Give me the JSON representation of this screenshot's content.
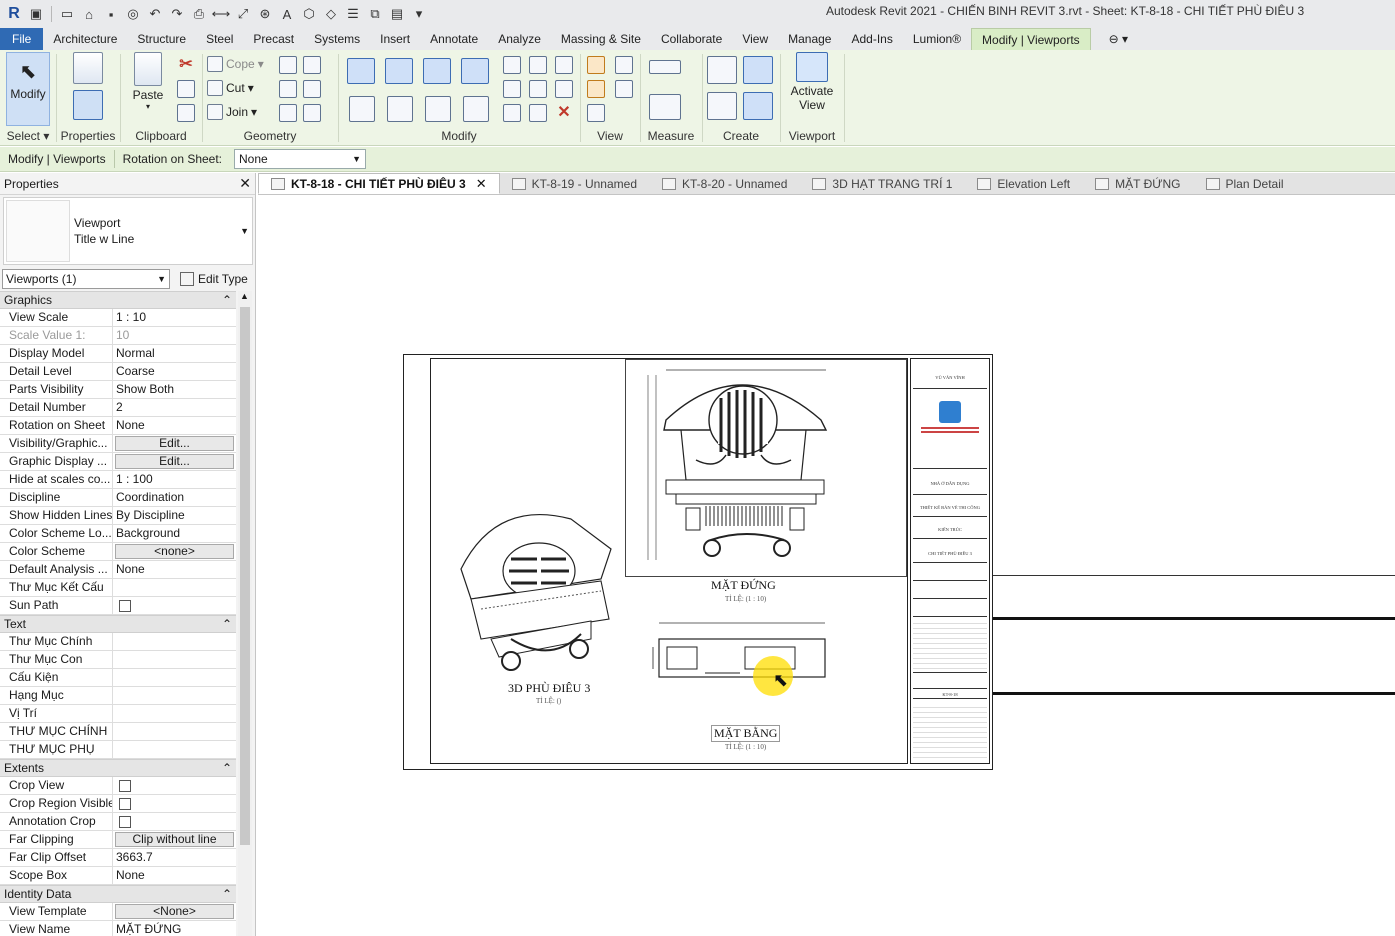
{
  "app": {
    "title": "Autodesk Revit 2021 - CHIẾN BINH REVIT 3.rvt - Sheet: KT-8-18 - CHI TIẾT PHÙ ĐIÊU 3",
    "logo": "R"
  },
  "ribbon_tabs": [
    "File",
    "Architecture",
    "Structure",
    "Steel",
    "Precast",
    "Systems",
    "Insert",
    "Annotate",
    "Analyze",
    "Massing & Site",
    "Collaborate",
    "View",
    "Manage",
    "Add-Ins",
    "Lumion®",
    "Modify | Viewports"
  ],
  "ribbon": {
    "select": {
      "modify": "Modify",
      "label": "Select ▾"
    },
    "properties": {
      "label": "Properties"
    },
    "clipboard": {
      "paste": "Paste",
      "label": "Clipboard"
    },
    "geometry": {
      "cope": "Cope",
      "cut": "Cut",
      "join": "Join",
      "label": "Geometry"
    },
    "modify_panel": {
      "label": "Modify"
    },
    "view_panel": {
      "label": "View"
    },
    "measure_panel": {
      "label": "Measure"
    },
    "create_panel": {
      "label": "Create"
    },
    "viewport_panel": {
      "activate_line1": "Activate",
      "activate_line2": "View",
      "label": "Viewport"
    }
  },
  "options_bar": {
    "context": "Modify | Viewports",
    "rotation_label": "Rotation on Sheet:",
    "rotation_value": "None"
  },
  "properties": {
    "header": "Properties",
    "type_line1": "Viewport",
    "type_line2": "Title w Line",
    "selector": "Viewports (1)",
    "edit_type": "Edit Type",
    "groups": [
      {
        "name": "Graphics",
        "rows": [
          {
            "n": "View Scale",
            "v": "1 : 10"
          },
          {
            "n": "Scale Value    1:",
            "v": "10",
            "dim": true
          },
          {
            "n": "Display Model",
            "v": "Normal"
          },
          {
            "n": "Detail Level",
            "v": "Coarse"
          },
          {
            "n": "Parts Visibility",
            "v": "Show Both"
          },
          {
            "n": "Detail Number",
            "v": "2"
          },
          {
            "n": "Rotation on Sheet",
            "v": "None"
          },
          {
            "n": "Visibility/Graphic...",
            "v": "Edit...",
            "button": true
          },
          {
            "n": "Graphic Display ...",
            "v": "Edit...",
            "button": true
          },
          {
            "n": "Hide at scales co...",
            "v": "1 : 100"
          },
          {
            "n": "Discipline",
            "v": "Coordination"
          },
          {
            "n": "Show Hidden Lines",
            "v": "By Discipline"
          },
          {
            "n": "Color Scheme Lo...",
            "v": "Background"
          },
          {
            "n": "Color Scheme",
            "v": "<none>",
            "button": true
          },
          {
            "n": "Default Analysis ...",
            "v": "None"
          },
          {
            "n": "Thư Mục Kết Cấu",
            "v": ""
          },
          {
            "n": "Sun Path",
            "v": "",
            "check": true
          }
        ]
      },
      {
        "name": "Text",
        "rows": [
          {
            "n": "Thư Mục Chính",
            "v": ""
          },
          {
            "n": "Thư Mục Con",
            "v": ""
          },
          {
            "n": "Cấu Kiện",
            "v": ""
          },
          {
            "n": "Hạng Mục",
            "v": ""
          },
          {
            "n": "Vị Trí",
            "v": ""
          },
          {
            "n": "THƯ MỤC CHÍNH",
            "v": ""
          },
          {
            "n": "THƯ MỤC PHỤ",
            "v": ""
          }
        ]
      },
      {
        "name": "Extents",
        "rows": [
          {
            "n": "Crop View",
            "v": "",
            "check": true
          },
          {
            "n": "Crop Region Visible",
            "v": "",
            "check": true
          },
          {
            "n": "Annotation Crop",
            "v": "",
            "check": true
          },
          {
            "n": "Far Clipping",
            "v": "Clip without line",
            "button": true
          },
          {
            "n": "Far Clip Offset",
            "v": "3663.7"
          },
          {
            "n": "Scope Box",
            "v": "None"
          }
        ]
      },
      {
        "name": "Identity Data",
        "rows": [
          {
            "n": "View Template",
            "v": "<None>",
            "button": true
          },
          {
            "n": "View Name",
            "v": "MẶT ĐỨNG"
          }
        ]
      }
    ]
  },
  "view_tabs": [
    {
      "label": "KT-8-18 - CHI TIẾT PHÙ ĐIÊU 3",
      "active": true
    },
    {
      "label": "KT-8-19 - Unnamed"
    },
    {
      "label": "KT-8-20 - Unnamed"
    },
    {
      "label": "3D HẠT TRANG TRÍ 1"
    },
    {
      "label": "Elevation Left"
    },
    {
      "label": "MẶT ĐỨNG"
    },
    {
      "label": "Plan Detail"
    }
  ],
  "sheet": {
    "view_3d": {
      "title": "3D PHÙ ĐIÊU 3",
      "scale": "TỈ LỆ: ()"
    },
    "view_elev": {
      "title": "MẶT ĐỨNG",
      "scale": "TỈ LỆ: (1 : 10)"
    },
    "view_plan": {
      "title": "MẶT BẰNG",
      "scale": "TỈ LỆ: (1 : 10)"
    },
    "titleblock": {
      "designer": "VŨ VĂN VĨNH",
      "project": "NHÀ Ở DÂN DỤNG",
      "phase": "THIẾT KẾ BẢN VẼ THI CÔNG",
      "discipline": "KIẾN TRÚC",
      "sheet_name": "CHI TIẾT PHÙ ĐIÊU 3",
      "sheet_number": "KT-8-18"
    }
  },
  "colors": {
    "file_tab": "#2f6ab4",
    "context_tab": "#d9edc6",
    "ribbon_bg": "#eef5e6",
    "highlight": "#ffdd00"
  }
}
